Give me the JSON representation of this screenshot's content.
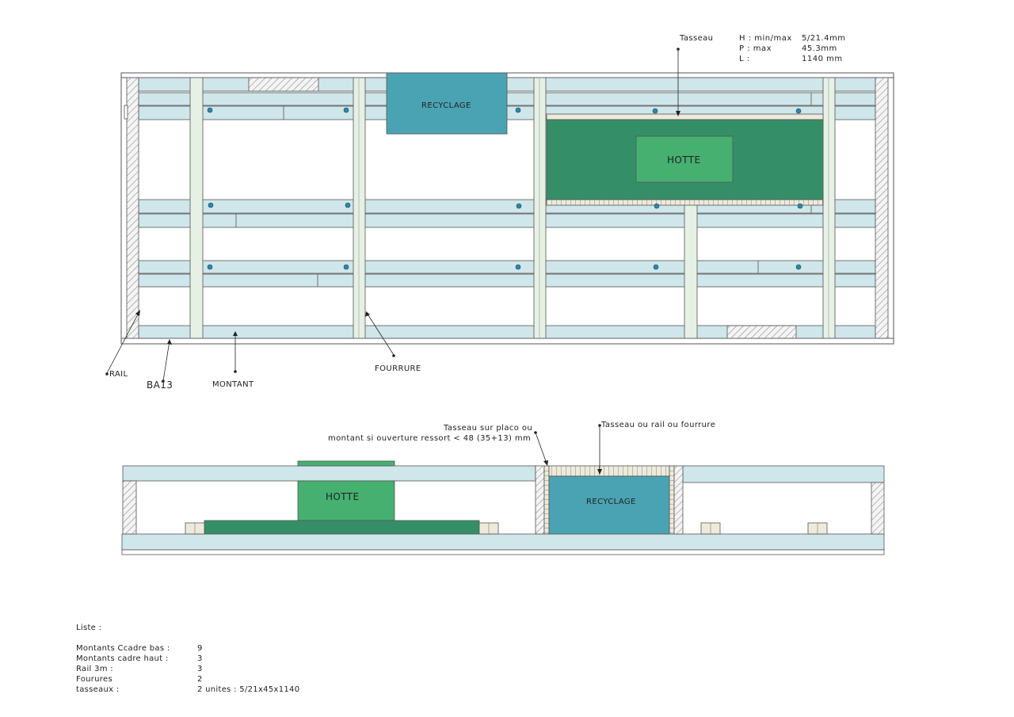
{
  "colors": {
    "board": "#cfe6ea",
    "board_stroke": "#4a4a4a",
    "stud": "#e6f0e4",
    "recyclage": "#4aa3b2",
    "hotte_dark": "#348f68",
    "hotte_light": "#45b070",
    "hatch": "#9a9a9a",
    "screw": "#2b88a8",
    "batten": "#eeeadb"
  },
  "top_view": {
    "labels": {
      "recyclage": "RECYCLAGE",
      "hotte": "HOTTE",
      "tasseau": "Tasseau",
      "rail": "RAIL",
      "ba13": "BA13",
      "montant": "MONTANT",
      "fourrure": "FOURRURE"
    },
    "spec": {
      "rows": [
        {
          "key": "H : min/max",
          "value": "5/21.4mm"
        },
        {
          "key": "P : max",
          "value": "45.3mm"
        },
        {
          "key": "L :",
          "value": "1140 mm"
        }
      ]
    }
  },
  "section_view": {
    "labels": {
      "hotte": "HOTTE",
      "recyclage": "RECYCLAGE",
      "tasseau_placo_1": "Tasseau sur placo ou",
      "tasseau_placo_2": "montant si ouverture ressort < 48 (35+13) mm",
      "tasseau_rail": "Tasseau ou rail ou fourrure"
    }
  },
  "list": {
    "title": "Liste :",
    "rows": [
      {
        "name": "Montants Ccadre bas :",
        "qty": "9"
      },
      {
        "name": "Montants cadre haut :",
        "qty": "3"
      },
      {
        "name": "Rail 3m :",
        "qty": "3"
      },
      {
        "name": "Fourures",
        "qty": "2"
      },
      {
        "name": "tasseaux :",
        "qty": "2 unites : 5/21x45x1140"
      }
    ]
  }
}
